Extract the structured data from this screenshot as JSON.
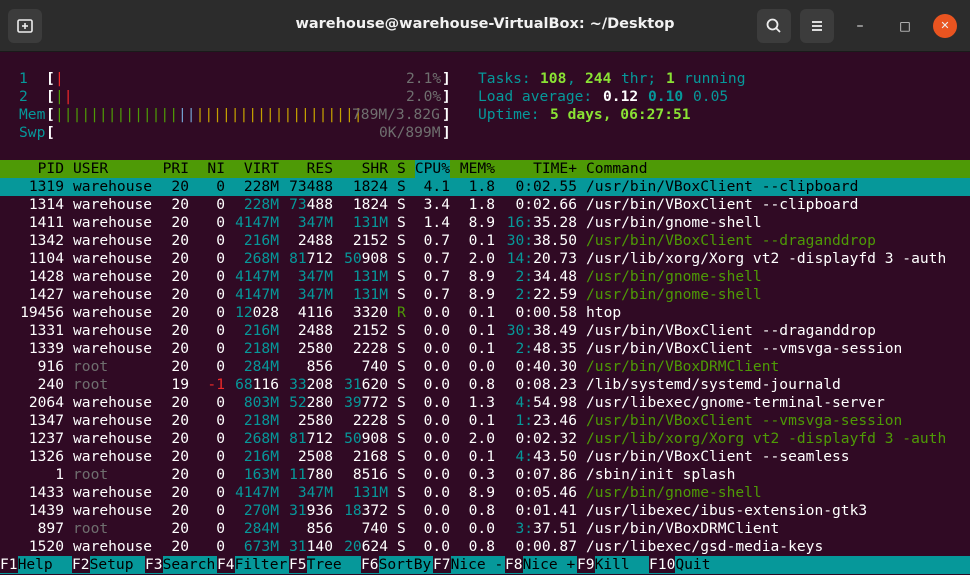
{
  "window": {
    "title": "warehouse@warehouse-VirtualBox: ~/Desktop",
    "new_tab_icon": "new-tab-icon",
    "search_icon": "search-icon",
    "menu_icon": "hamburger-menu-icon",
    "minimize": "–",
    "maximize": "□",
    "close": "✕"
  },
  "meters": {
    "cpu1": {
      "label": "1",
      "bar": "|",
      "value": "2.1%"
    },
    "cpu2": {
      "label": "2",
      "bar": "||",
      "value": "2.0%"
    },
    "mem": {
      "label": "Mem",
      "bar": "|||||||||||||||||||||||||||||||||||",
      "value": "789M/3.82G"
    },
    "swp": {
      "label": "Swp",
      "bar": "",
      "value": "0K/899M"
    }
  },
  "stats": {
    "tasks_label": "Tasks:",
    "tasks": "108",
    "thr": "244",
    "thr_label": "thr;",
    "running": "1",
    "running_label": "running",
    "load_label": "Load average:",
    "load1": "0.12",
    "load5": "0.10",
    "load15": "0.05",
    "uptime_label": "Uptime:",
    "uptime": "5 days, 06:27:51"
  },
  "columns": [
    "PID",
    "USER",
    "PRI",
    "NI",
    "VIRT",
    "RES",
    "SHR",
    "S",
    "CPU%",
    "MEM%",
    "TIME+",
    "Command"
  ],
  "processes": [
    {
      "pid": "1319",
      "user": "warehouse",
      "pri": "20",
      "ni": "0",
      "virt": "228M",
      "res": "73488",
      "shr": "1824",
      "s": "S",
      "cpu": "4.1",
      "mem": "1.8",
      "time": "0:02.55",
      "cmd": "/usr/bin/VBoxClient --clipboard"
    },
    {
      "pid": "1314",
      "user": "warehouse",
      "pri": "20",
      "ni": "0",
      "virt": "228M",
      "res": "73488",
      "shr": "1824",
      "s": "S",
      "cpu": "3.4",
      "mem": "1.8",
      "time": "0:02.66",
      "cmd": "/usr/bin/VBoxClient --clipboard"
    },
    {
      "pid": "1411",
      "user": "warehouse",
      "pri": "20",
      "ni": "0",
      "virt": "4147M",
      "res": "347M",
      "shr": "131M",
      "s": "S",
      "cpu": "1.4",
      "mem": "8.9",
      "time": "16:35.28",
      "cmd": "/usr/bin/gnome-shell"
    },
    {
      "pid": "1342",
      "user": "warehouse",
      "pri": "20",
      "ni": "0",
      "virt": "216M",
      "res": "2488",
      "shr": "2152",
      "s": "S",
      "cpu": "0.7",
      "mem": "0.1",
      "time": "30:38.50",
      "cmd": "/usr/bin/VBoxClient --draganddrop"
    },
    {
      "pid": "1104",
      "user": "warehouse",
      "pri": "20",
      "ni": "0",
      "virt": "268M",
      "res": "81712",
      "shr": "50908",
      "s": "S",
      "cpu": "0.7",
      "mem": "2.0",
      "time": "14:20.73",
      "cmd": "/usr/lib/xorg/Xorg vt2 -displayfd 3 -auth"
    },
    {
      "pid": "1428",
      "user": "warehouse",
      "pri": "20",
      "ni": "0",
      "virt": "4147M",
      "res": "347M",
      "shr": "131M",
      "s": "S",
      "cpu": "0.7",
      "mem": "8.9",
      "time": "2:34.48",
      "cmd": "/usr/bin/gnome-shell"
    },
    {
      "pid": "1427",
      "user": "warehouse",
      "pri": "20",
      "ni": "0",
      "virt": "4147M",
      "res": "347M",
      "shr": "131M",
      "s": "S",
      "cpu": "0.7",
      "mem": "8.9",
      "time": "2:22.59",
      "cmd": "/usr/bin/gnome-shell"
    },
    {
      "pid": "19456",
      "user": "warehouse",
      "pri": "20",
      "ni": "0",
      "virt": "12028",
      "res": "4116",
      "shr": "3320",
      "s": "R",
      "cpu": "0.0",
      "mem": "0.1",
      "time": "0:00.58",
      "cmd": "htop"
    },
    {
      "pid": "1331",
      "user": "warehouse",
      "pri": "20",
      "ni": "0",
      "virt": "216M",
      "res": "2488",
      "shr": "2152",
      "s": "S",
      "cpu": "0.0",
      "mem": "0.1",
      "time": "30:38.49",
      "cmd": "/usr/bin/VBoxClient --draganddrop"
    },
    {
      "pid": "1339",
      "user": "warehouse",
      "pri": "20",
      "ni": "0",
      "virt": "218M",
      "res": "2580",
      "shr": "2228",
      "s": "S",
      "cpu": "0.0",
      "mem": "0.1",
      "time": "2:48.35",
      "cmd": "/usr/bin/VBoxClient --vmsvga-session"
    },
    {
      "pid": "916",
      "user": "root",
      "pri": "20",
      "ni": "0",
      "virt": "284M",
      "res": "856",
      "shr": "740",
      "s": "S",
      "cpu": "0.0",
      "mem": "0.0",
      "time": "0:40.30",
      "cmd": "/usr/bin/VBoxDRMClient"
    },
    {
      "pid": "240",
      "user": "root",
      "pri": "19",
      "ni": "-1",
      "virt": "68116",
      "res": "33208",
      "shr": "31620",
      "s": "S",
      "cpu": "0.0",
      "mem": "0.8",
      "time": "0:08.23",
      "cmd": "/lib/systemd/systemd-journald"
    },
    {
      "pid": "2064",
      "user": "warehouse",
      "pri": "20",
      "ni": "0",
      "virt": "803M",
      "res": "52280",
      "shr": "39772",
      "s": "S",
      "cpu": "0.0",
      "mem": "1.3",
      "time": "4:54.98",
      "cmd": "/usr/libexec/gnome-terminal-server"
    },
    {
      "pid": "1347",
      "user": "warehouse",
      "pri": "20",
      "ni": "0",
      "virt": "218M",
      "res": "2580",
      "shr": "2228",
      "s": "S",
      "cpu": "0.0",
      "mem": "0.1",
      "time": "1:23.46",
      "cmd": "/usr/bin/VBoxClient --vmsvga-session"
    },
    {
      "pid": "1237",
      "user": "warehouse",
      "pri": "20",
      "ni": "0",
      "virt": "268M",
      "res": "81712",
      "shr": "50908",
      "s": "S",
      "cpu": "0.0",
      "mem": "2.0",
      "time": "0:02.32",
      "cmd": "/usr/lib/xorg/Xorg vt2 -displayfd 3 -auth"
    },
    {
      "pid": "1326",
      "user": "warehouse",
      "pri": "20",
      "ni": "0",
      "virt": "216M",
      "res": "2508",
      "shr": "2168",
      "s": "S",
      "cpu": "0.0",
      "mem": "0.1",
      "time": "4:43.50",
      "cmd": "/usr/bin/VBoxClient --seamless"
    },
    {
      "pid": "1",
      "user": "root",
      "pri": "20",
      "ni": "0",
      "virt": "163M",
      "res": "11780",
      "shr": "8516",
      "s": "S",
      "cpu": "0.0",
      "mem": "0.3",
      "time": "0:07.86",
      "cmd": "/sbin/init splash"
    },
    {
      "pid": "1433",
      "user": "warehouse",
      "pri": "20",
      "ni": "0",
      "virt": "4147M",
      "res": "347M",
      "shr": "131M",
      "s": "S",
      "cpu": "0.0",
      "mem": "8.9",
      "time": "0:05.46",
      "cmd": "/usr/bin/gnome-shell"
    },
    {
      "pid": "1439",
      "user": "warehouse",
      "pri": "20",
      "ni": "0",
      "virt": "270M",
      "res": "31936",
      "shr": "18372",
      "s": "S",
      "cpu": "0.0",
      "mem": "0.8",
      "time": "0:01.41",
      "cmd": "/usr/libexec/ibus-extension-gtk3"
    },
    {
      "pid": "897",
      "user": "root",
      "pri": "20",
      "ni": "0",
      "virt": "284M",
      "res": "856",
      "shr": "740",
      "s": "S",
      "cpu": "0.0",
      "mem": "0.0",
      "time": "3:37.51",
      "cmd": "/usr/bin/VBoxDRMClient"
    },
    {
      "pid": "1520",
      "user": "warehouse",
      "pri": "20",
      "ni": "0",
      "virt": "673M",
      "res": "31140",
      "shr": "20624",
      "s": "S",
      "cpu": "0.0",
      "mem": "0.8",
      "time": "0:00.87",
      "cmd": "/usr/libexec/gsd-media-keys"
    }
  ],
  "thread_rows": [
    3,
    5,
    6,
    10,
    13,
    14,
    17
  ],
  "selected_row": 0,
  "function_keys": [
    {
      "key": "F1",
      "label": "Help"
    },
    {
      "key": "F2",
      "label": "Setup"
    },
    {
      "key": "F3",
      "label": "Search"
    },
    {
      "key": "F4",
      "label": "Filter"
    },
    {
      "key": "F5",
      "label": "Tree"
    },
    {
      "key": "F6",
      "label": "SortBy"
    },
    {
      "key": "F7",
      "label": "Nice -"
    },
    {
      "key": "F8",
      "label": "Nice +"
    },
    {
      "key": "F9",
      "label": "Kill"
    },
    {
      "key": "F10",
      "label": "Quit"
    }
  ]
}
